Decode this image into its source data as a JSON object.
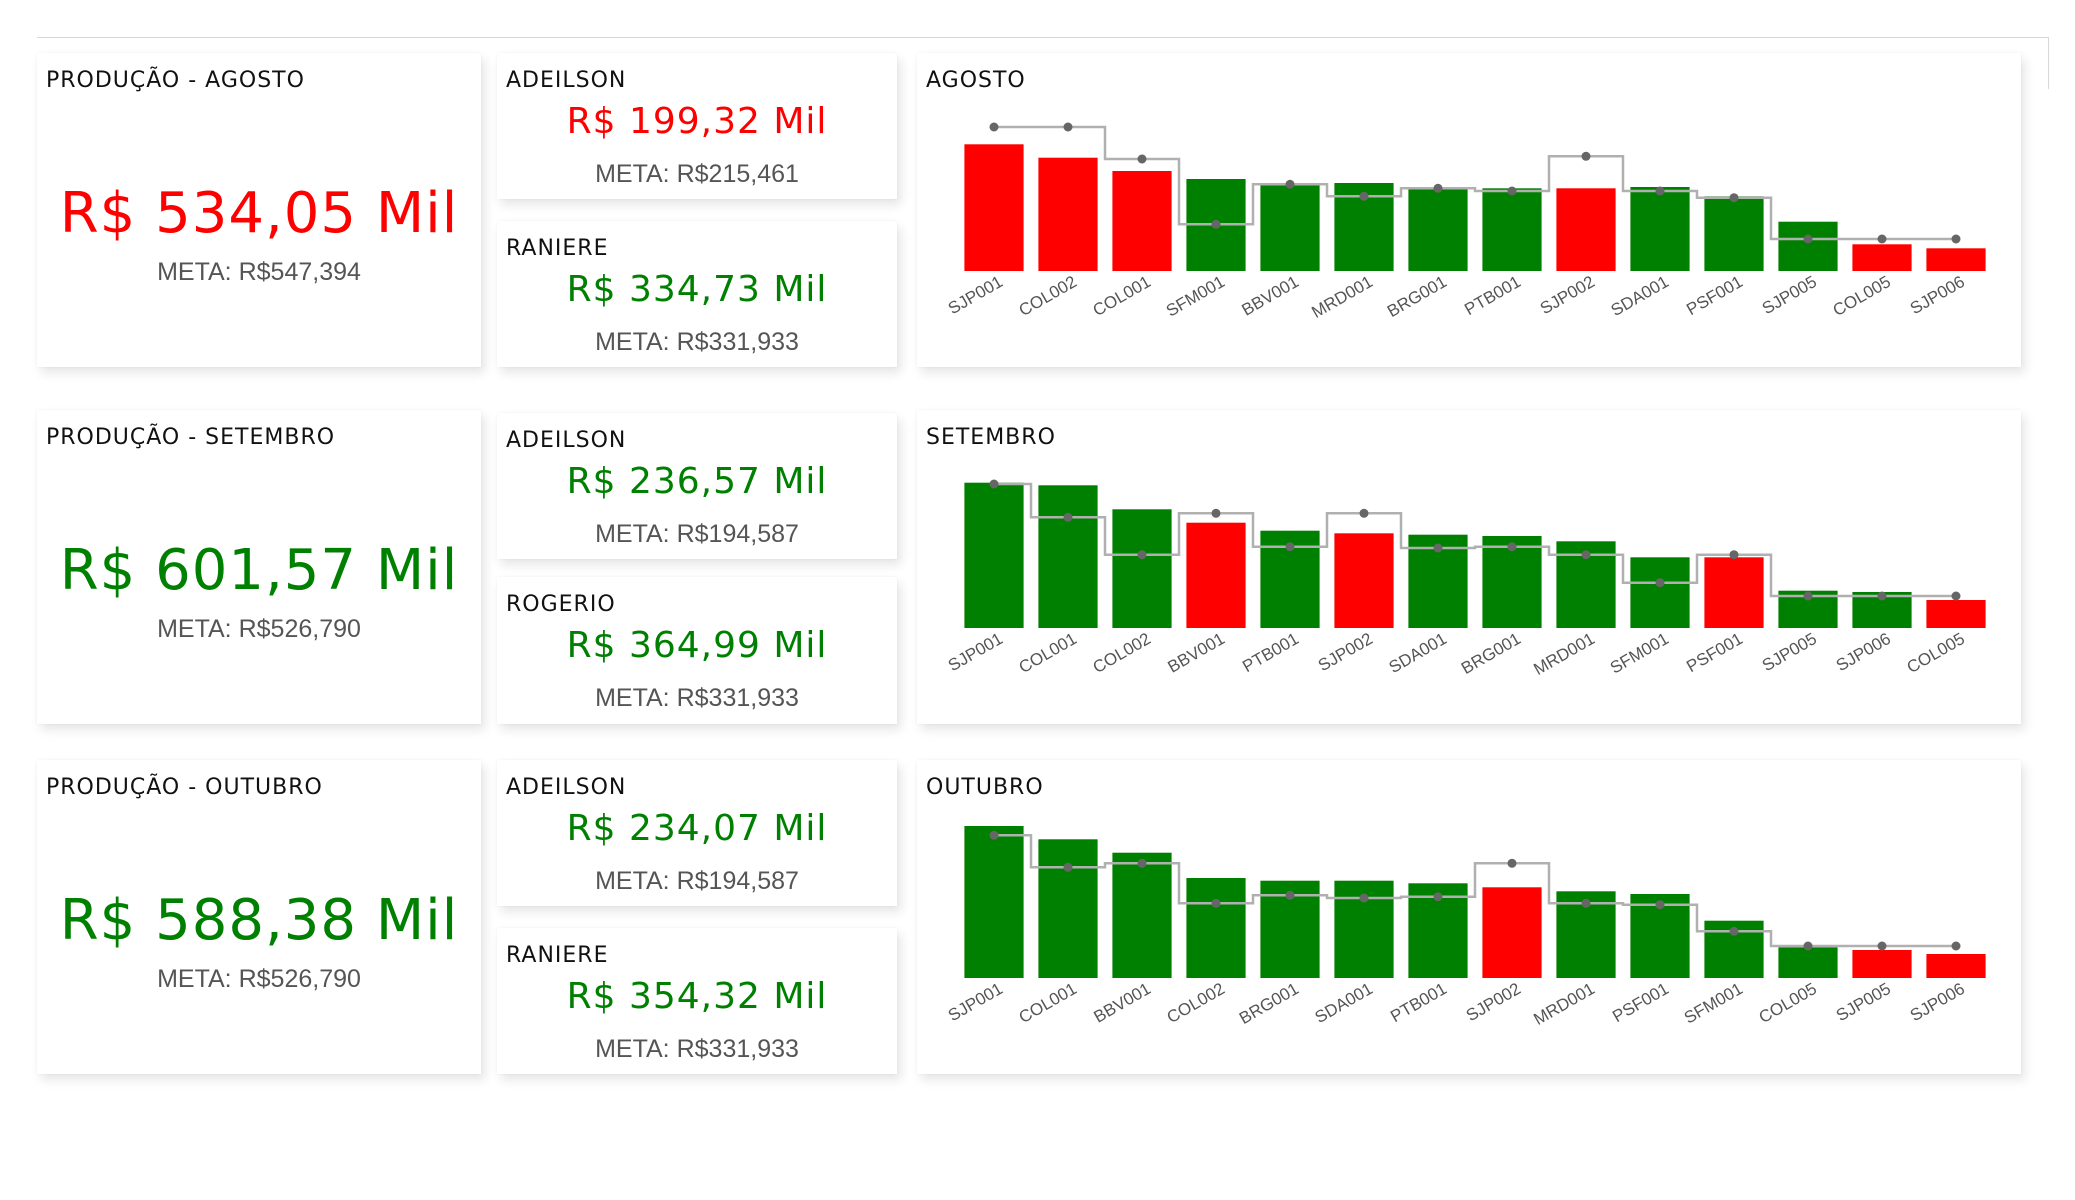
{
  "colors": {
    "green": "#008000",
    "red": "#ff0000",
    "target_line": "#b0b0b0",
    "target_dot": "#666666"
  },
  "months": [
    {
      "total": {
        "title": "PRODUÇÃO - AGOSTO",
        "value": "R$ 534,05 Mil",
        "meta": "META: R$547,394",
        "status": "red"
      },
      "people": [
        {
          "name": "ADEILSON",
          "value": "R$ 199,32 Mil",
          "meta": "META: R$215,461",
          "status": "red"
        },
        {
          "name": "RANIERE",
          "value": "R$ 334,73 Mil",
          "meta": "META: R$331,933",
          "status": "green"
        }
      ],
      "chart_title": "AGOSTO"
    },
    {
      "total": {
        "title": "PRODUÇÃO - SETEMBRO",
        "value": "R$ 601,57 Mil",
        "meta": "META: R$526,790",
        "status": "green"
      },
      "people": [
        {
          "name": "ADEILSON",
          "value": "R$ 236,57 Mil",
          "meta": "META: R$194,587",
          "status": "green"
        },
        {
          "name": "ROGERIO",
          "value": "R$ 364,99 Mil",
          "meta": "META: R$331,933",
          "status": "green"
        }
      ],
      "chart_title": "SETEMBRO"
    },
    {
      "total": {
        "title": "PRODUÇÃO - OUTUBRO",
        "value": "R$ 588,38 Mil",
        "meta": "META: R$526,790",
        "status": "green"
      },
      "people": [
        {
          "name": "ADEILSON",
          "value": "R$ 234,07 Mil",
          "meta": "META: R$194,587",
          "status": "green"
        },
        {
          "name": "RANIERE",
          "value": "R$ 354,32 Mil",
          "meta": "META: R$331,933",
          "status": "green"
        }
      ],
      "chart_title": "OUTUBRO"
    }
  ],
  "chart_data": [
    {
      "type": "bar",
      "title": "AGOSTO",
      "categories": [
        "SJP001",
        "COL002",
        "COL001",
        "SFM001",
        "BBV001",
        "MRD001",
        "BRG001",
        "PTB001",
        "SJP002",
        "SDA001",
        "PSF001",
        "SJP005",
        "COL005",
        "SJP006"
      ],
      "series": [
        {
          "values": [
            95,
            85,
            75,
            69,
            66,
            66,
            63,
            62,
            62,
            63,
            56,
            37,
            20,
            17
          ],
          "colors": [
            "red",
            "red",
            "red",
            "green",
            "green",
            "green",
            "green",
            "green",
            "red",
            "green",
            "green",
            "green",
            "red",
            "red"
          ]
        },
        {
          "values": [
            108,
            108,
            84,
            35,
            65,
            56,
            62,
            60,
            86,
            60,
            55,
            24,
            24,
            24
          ]
        }
      ],
      "ylim": [
        0,
        120
      ]
    },
    {
      "type": "bar",
      "title": "SETEMBRO",
      "categories": [
        "SJP001",
        "COL001",
        "COL002",
        "BBV001",
        "PTB001",
        "SJP002",
        "SDA001",
        "BRG001",
        "MRD001",
        "SFM001",
        "PSF001",
        "SJP005",
        "SJP006",
        "COL005"
      ],
      "series": [
        {
          "values": [
            109,
            107,
            89,
            79,
            73,
            71,
            70,
            69,
            65,
            53,
            53,
            28,
            27,
            21
          ],
          "colors": [
            "green",
            "green",
            "green",
            "red",
            "green",
            "red",
            "green",
            "green",
            "green",
            "green",
            "red",
            "green",
            "green",
            "red"
          ]
        },
        {
          "values": [
            108,
            83,
            55,
            86,
            61,
            86,
            60,
            61,
            55,
            34,
            55,
            24,
            24,
            24
          ]
        }
      ],
      "ylim": [
        0,
        120
      ]
    },
    {
      "type": "bar",
      "title": "OUTUBRO",
      "categories": [
        "SJP001",
        "COL001",
        "BBV001",
        "COL002",
        "BRG001",
        "SDA001",
        "PTB001",
        "SJP002",
        "MRD001",
        "PSF001",
        "SFM001",
        "COL005",
        "SJP005",
        "SJP006"
      ],
      "series": [
        {
          "values": [
            114,
            104,
            94,
            75,
            73,
            73,
            71,
            68,
            65,
            63,
            43,
            23,
            21,
            18
          ],
          "colors": [
            "green",
            "green",
            "green",
            "green",
            "green",
            "green",
            "green",
            "red",
            "green",
            "green",
            "green",
            "green",
            "red",
            "red"
          ]
        },
        {
          "values": [
            107,
            83,
            86,
            56,
            62,
            60,
            61,
            86,
            56,
            55,
            35,
            24,
            24,
            24
          ]
        }
      ],
      "ylim": [
        0,
        120
      ]
    }
  ]
}
